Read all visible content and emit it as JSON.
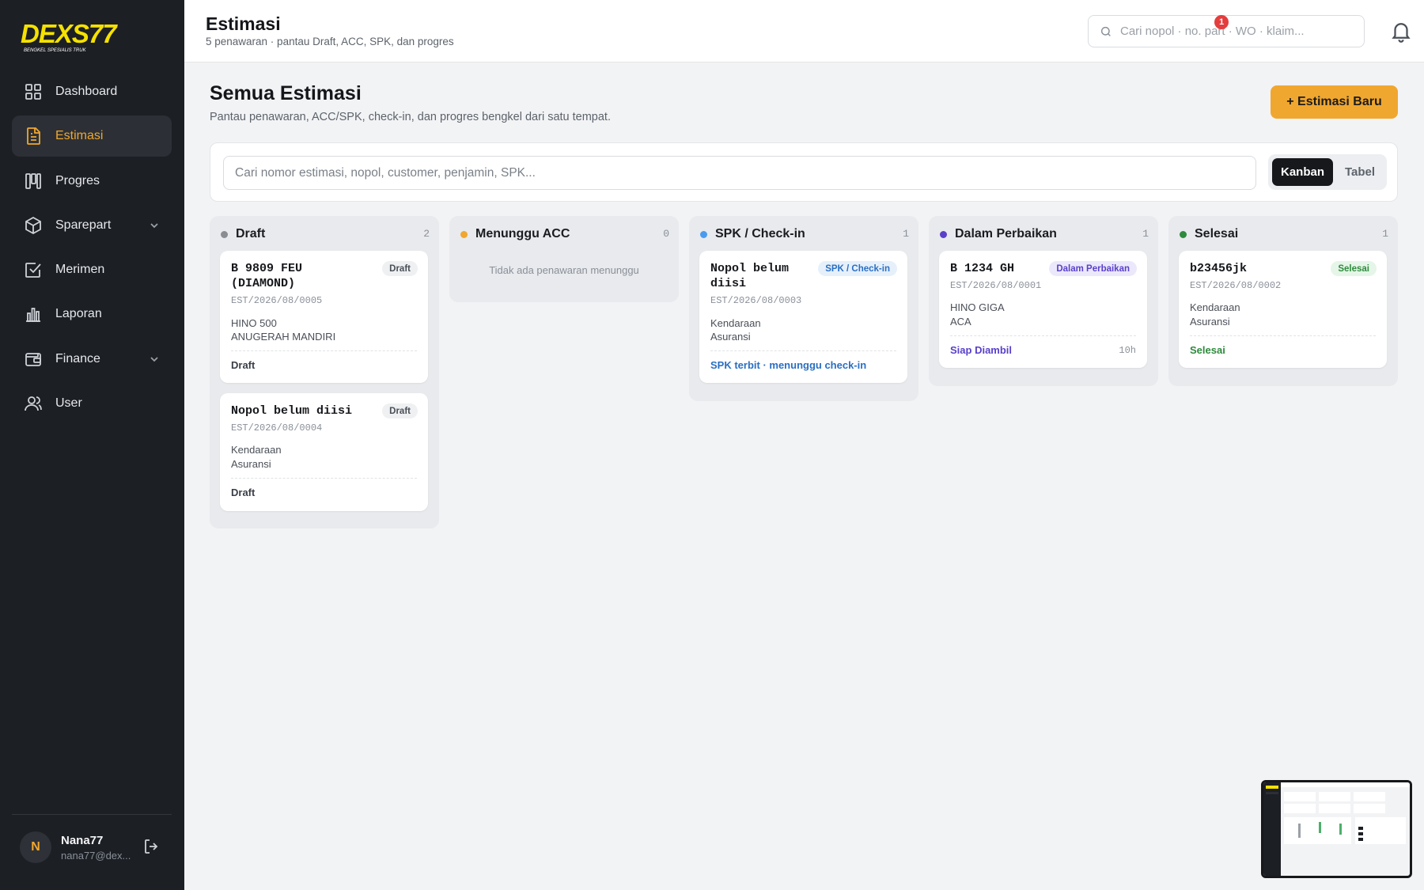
{
  "sidebar": {
    "brand": "DEXS77",
    "brand_tagline": "BENGKEL SPESIALIS TRUK",
    "items": [
      {
        "label": "Dashboard",
        "icon": "grid-icon"
      },
      {
        "label": "Estimasi",
        "icon": "document-icon",
        "active": true
      },
      {
        "label": "Progres",
        "icon": "kanban-icon"
      },
      {
        "label": "Sparepart",
        "icon": "box-icon",
        "has_children": true
      },
      {
        "label": "Merimen",
        "icon": "checkbox-icon"
      },
      {
        "label": "Laporan",
        "icon": "bar-chart-icon"
      },
      {
        "label": "Finance",
        "icon": "wallet-icon",
        "has_children": true
      },
      {
        "label": "User",
        "icon": "users-icon"
      }
    ],
    "user": {
      "initial": "N",
      "name": "Nana77",
      "email": "nana77@dex..."
    }
  },
  "header": {
    "title": "Estimasi",
    "subtitle": "5 penawaran · pantau Draft, ACC, SPK, dan progres",
    "search_placeholder": "Cari nopol · no. part · WO · klaim...",
    "notification_count": "1"
  },
  "main": {
    "title": "Semua Estimasi",
    "subtitle": "Pantau penawaran, ACC/SPK, check-in, dan progres bengkel dari satu tempat.",
    "new_button": "+ Estimasi Baru",
    "filter_placeholder": "Cari nomor estimasi, nopol, customer, penjamin, SPK...",
    "view_toggle": {
      "kanban": "Kanban",
      "table": "Tabel",
      "selected": "Kanban"
    }
  },
  "colors": {
    "accent": "#f0a72f",
    "sidebar_bg": "#1c1f24",
    "draft": "#8a8d93",
    "waiting": "#f0a72f",
    "spk": "#4a9bf0",
    "repair": "#5a40c9",
    "done": "#2e8a3d"
  },
  "columns": [
    {
      "title": "Draft",
      "count": "2",
      "dot_color": "#8a8d93",
      "cards": [
        {
          "plate": "B 9809 FEU (DIAMOND)",
          "badge": "Draft",
          "code": "EST/2026/08/0005",
          "line1": "HINO 500",
          "line2": "ANUGERAH MANDIRI",
          "status": "Draft",
          "status_color": "#3a3f47",
          "time": ""
        },
        {
          "plate": "Nopol belum diisi",
          "badge": "Draft",
          "code": "EST/2026/08/0004",
          "line1": "Kendaraan",
          "line2": "Asuransi",
          "status": "Draft",
          "status_color": "#3a3f47",
          "time": ""
        }
      ]
    },
    {
      "title": "Menunggu ACC",
      "count": "0",
      "dot_color": "#f0a72f",
      "empty_text": "Tidak ada penawaran menunggu",
      "cards": []
    },
    {
      "title": "SPK / Check-in",
      "count": "1",
      "dot_color": "#4a9bf0",
      "cards": [
        {
          "plate": "Nopol belum diisi",
          "badge": "SPK / Check-in",
          "code": "EST/2026/08/0003",
          "line1": "Kendaraan",
          "line2": "Asuransi",
          "status": "SPK terbit · menunggu check-in",
          "status_color": "#2a6fc2",
          "time": ""
        }
      ]
    },
    {
      "title": "Dalam Perbaikan",
      "count": "1",
      "dot_color": "#5a40c9",
      "cards": [
        {
          "plate": "B 1234 GH",
          "badge": "Dalam Perbaikan",
          "code": "EST/2026/08/0001",
          "line1": "HINO GIGA",
          "line2": "ACA",
          "status": "Siap Diambil",
          "status_color": "#5a40c9",
          "time": "10h"
        }
      ]
    },
    {
      "title": "Selesai",
      "count": "1",
      "dot_color": "#2e8a3d",
      "cards": [
        {
          "plate": "b23456jk",
          "badge": "Selesai",
          "code": "EST/2026/08/0002",
          "line1": "Kendaraan",
          "line2": "Asuransi",
          "status": "Selesai",
          "status_color": "#2e8a3d",
          "time": ""
        }
      ]
    }
  ]
}
